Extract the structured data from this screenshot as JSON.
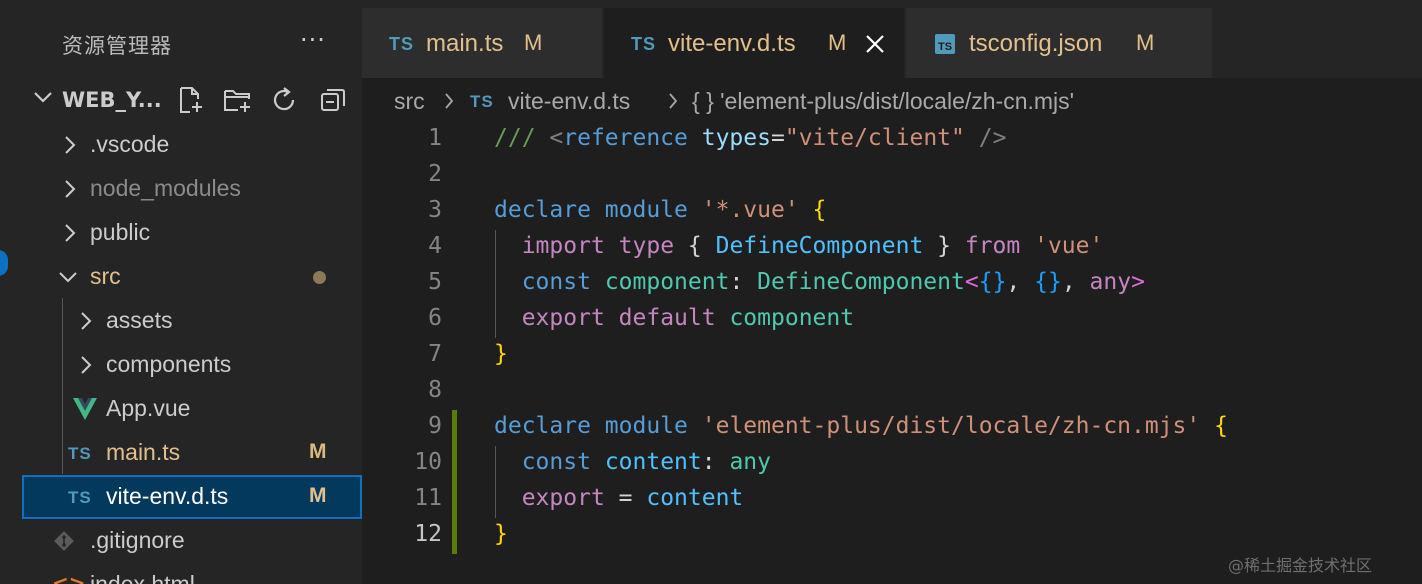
{
  "sidebar": {
    "title": "资源管理器",
    "more_label": "···",
    "folder": {
      "name": "WEB_Y..."
    },
    "items": [
      {
        "label": ".vscode",
        "kind": "folder"
      },
      {
        "label": "node_modules",
        "kind": "folder"
      },
      {
        "label": "public",
        "kind": "folder"
      },
      {
        "label": "src",
        "kind": "folder-open"
      },
      {
        "label": "assets",
        "kind": "folder"
      },
      {
        "label": "components",
        "kind": "folder"
      },
      {
        "label": "App.vue",
        "kind": "vue-file"
      },
      {
        "label": "main.ts",
        "kind": "ts-file",
        "status": "M"
      },
      {
        "label": "vite-env.d.ts",
        "kind": "ts-file",
        "status": "M"
      },
      {
        "label": ".gitignore",
        "kind": "git-file"
      },
      {
        "label": "index.html",
        "kind": "html-file"
      }
    ]
  },
  "tabs": [
    {
      "label": "main.ts",
      "status": "M",
      "icon": "TS"
    },
    {
      "label": "vite-env.d.ts",
      "status": "M",
      "icon": "TS"
    },
    {
      "label": "tsconfig.json",
      "status": "M",
      "icon": "json-icon"
    }
  ],
  "breadcrumb": {
    "folder": "src",
    "file_icon": "TS",
    "file": "vite-env.d.ts",
    "symbol": "{ } 'element-plus/dist/locale/zh-cn.mjs'"
  },
  "editor": {
    "line_numbers": [
      "1",
      "2",
      "3",
      "4",
      "5",
      "6",
      "7",
      "8",
      "9",
      "10",
      "11",
      "12"
    ],
    "lines": [
      "/// <reference types=\"vite/client\" />",
      "",
      "declare module '*.vue' {",
      "  import type { DefineComponent } from 'vue'",
      "  const component: DefineComponent<{}, {}, any>",
      "  export default component",
      "}",
      "",
      "declare module 'element-plus/dist/locale/zh-cn.mjs' {",
      "  const content: any",
      "  export = content",
      "}"
    ]
  },
  "watermark": "@稀土掘金技术社区",
  "colors": {
    "sidebar_bg": "#252526",
    "editor_bg": "#1e1e1e",
    "selection": "#04395e",
    "focus_border": "#0e70c0",
    "modified": "#e2c08d",
    "ts_blue": "#519aba",
    "vue_green": "#41b883",
    "git_added": "#587c0c"
  }
}
